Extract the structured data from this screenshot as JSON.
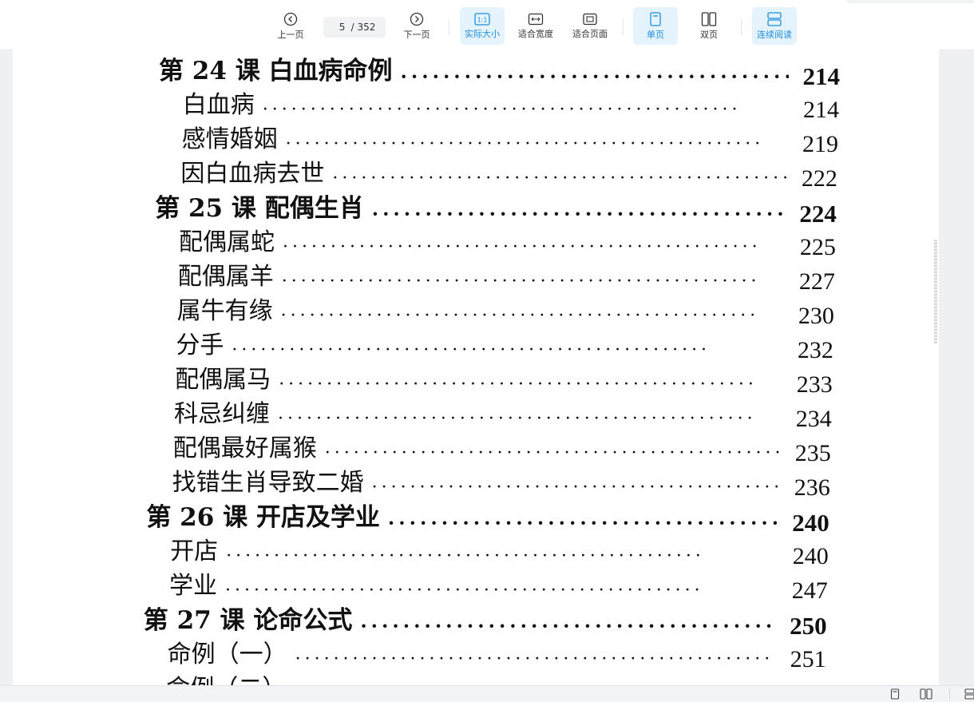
{
  "toolbar": {
    "prev_label": "上一页",
    "next_label": "下一页",
    "current_page": "5",
    "total_pages": "/ 352",
    "actual_size_label": "实际大小",
    "actual_size_glyph": "1:1",
    "fit_width_label": "适合宽度",
    "fit_page_label": "适合页面",
    "single_page_label": "单页",
    "double_page_label": "双页",
    "continuous_label": "连续阅读",
    "accent_color": "#1d8ee0",
    "active_bg": "#e5f3fd"
  },
  "toc": [
    {
      "title": "第 24 课  白血病命例",
      "page": "214",
      "type": "lesson"
    },
    {
      "title": "白血病",
      "page": "214",
      "type": "sub"
    },
    {
      "title": "感情婚姻",
      "page": "219",
      "type": "sub"
    },
    {
      "title": "因白血病去世",
      "page": "222",
      "type": "sub"
    },
    {
      "title": "第 25 课  配偶生肖",
      "page": "224",
      "type": "lesson"
    },
    {
      "title": "配偶属蛇",
      "page": "225",
      "type": "sub"
    },
    {
      "title": "配偶属羊",
      "page": "227",
      "type": "sub"
    },
    {
      "title": "属牛有缘",
      "page": "230",
      "type": "sub"
    },
    {
      "title": "分手",
      "page": "232",
      "type": "sub"
    },
    {
      "title": "配偶属马",
      "page": "233",
      "type": "sub"
    },
    {
      "title": "科忌纠缠",
      "page": "234",
      "type": "sub"
    },
    {
      "title": "配偶最好属猴",
      "page": "235",
      "type": "sub"
    },
    {
      "title": "找错生肖导致二婚",
      "page": "236",
      "type": "sub"
    },
    {
      "title": "第 26 课  开店及学业",
      "page": "240",
      "type": "lesson"
    },
    {
      "title": "开店",
      "page": "240",
      "type": "sub"
    },
    {
      "title": "学业",
      "page": "247",
      "type": "sub"
    },
    {
      "title": "第 27 课  论命公式",
      "page": "250",
      "type": "lesson"
    },
    {
      "title": "命例（一）",
      "page": "251",
      "type": "sub"
    },
    {
      "title": "命例（二）",
      "page": "",
      "type": "sub"
    }
  ],
  "leader": "··················································"
}
